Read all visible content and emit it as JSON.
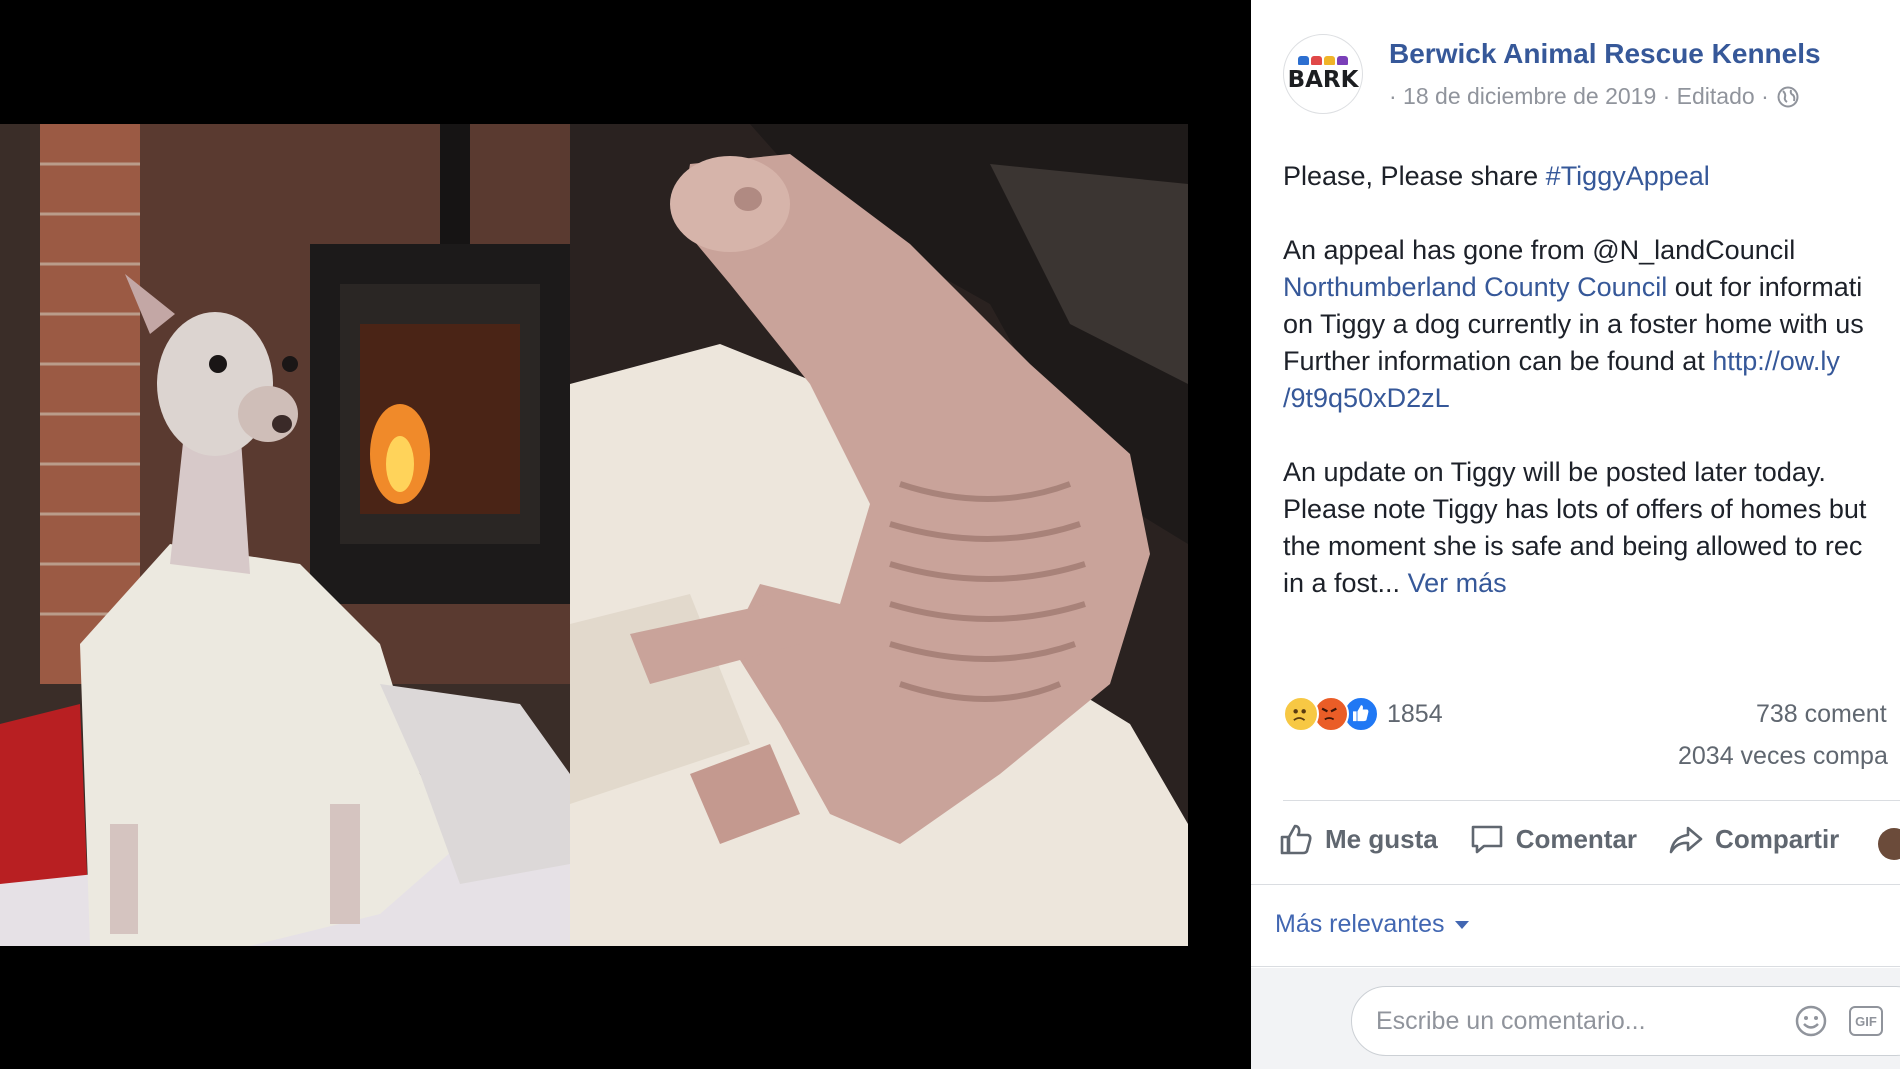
{
  "post": {
    "page_name": "Berwick Animal Rescue Kennels",
    "avatar_text": "BARK",
    "date": "· 18 de diciembre de 2019 · Editado ·",
    "body": {
      "line1_prefix": "Please, Please share ",
      "hashtag": "#TiggyAppeal",
      "p2_line1": "An appeal has gone from @N_landCouncil",
      "p2_link": "Northumberland County Council",
      "p2_line2_suffix": " out for informati",
      "p2_line3": "on Tiggy a dog currently in a foster home with us",
      "p2_line4_prefix": "Further information can be found at ",
      "p2_url_part1": "http://ow.ly",
      "p2_url_part2": "/9t9q50xD2zL",
      "p3_line1": "An update on Tiggy will be posted later today.",
      "p3_line2": "Please note Tiggy has lots of offers of homes but",
      "p3_line3": "the moment she is safe and being allowed to rec",
      "p3_line4_prefix": "in a fost...",
      "see_more": "Ver más"
    },
    "reactions": {
      "icons": [
        "sad-reaction",
        "angry-reaction",
        "like-reaction"
      ],
      "count": "1854",
      "comments": "738 coment",
      "shares": "2034 veces compa"
    },
    "actions": {
      "like": "Me gusta",
      "comment": "Comentar",
      "share": "Compartir"
    },
    "sort_label": "Más relevantes",
    "comment_placeholder": "Escribe un comentario...",
    "gif_label": "GIF"
  },
  "colors": {
    "link": "#365899",
    "sort": "#4267b2",
    "text": "#1d2129",
    "muted": "#606770"
  }
}
